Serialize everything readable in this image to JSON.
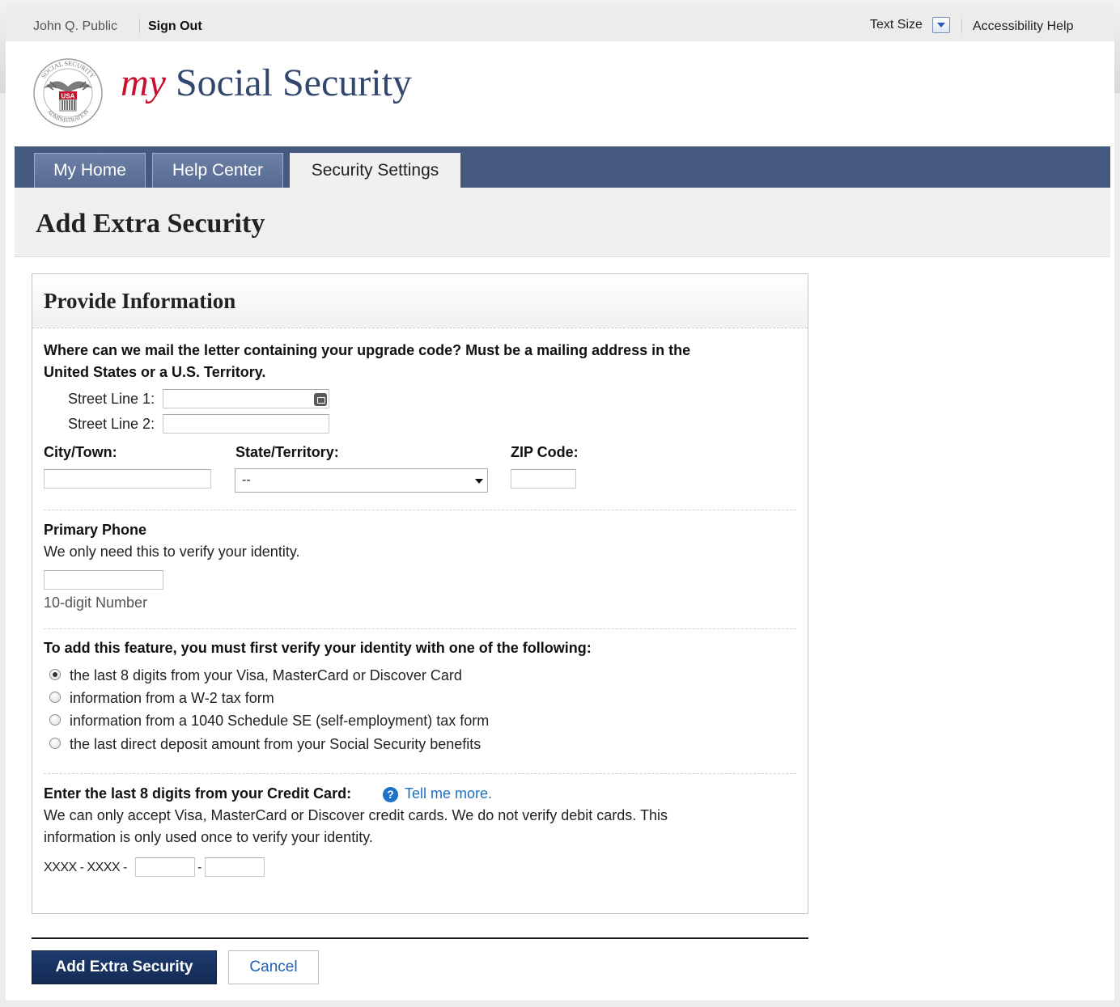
{
  "utility": {
    "user_name": "John Q. Public",
    "sign_out": "Sign Out",
    "text_size": "Text Size",
    "accessibility_help": "Accessibility Help"
  },
  "header": {
    "brand_my": "my",
    "brand_rest": "Social Security",
    "seal_text_top": "SOCIAL SECURITY",
    "seal_text_bottom": "ADMINISTRATION",
    "seal_center": "USA"
  },
  "nav": {
    "tabs": [
      {
        "label": "My Home",
        "active": false
      },
      {
        "label": "Help Center",
        "active": false
      },
      {
        "label": "Security Settings",
        "active": true
      }
    ]
  },
  "page": {
    "title": "Add Extra Security"
  },
  "panel": {
    "title": "Provide Information",
    "address": {
      "question_line1": "Where can we mail the letter containing your upgrade code? Must be a mailing address in the",
      "question_line2": "United States or a U.S. Territory.",
      "street1_label": "Street Line 1:",
      "street1_value": "",
      "street2_label": "Street Line 2:",
      "street2_value": "",
      "city_label": "City/Town:",
      "city_value": "",
      "state_label": "State/Territory:",
      "state_selected": "--",
      "zip_label": "ZIP Code:",
      "zip_value": ""
    },
    "phone": {
      "label": "Primary Phone",
      "help": "We only need this to verify your identity.",
      "value": "",
      "hint": "10-digit Number"
    },
    "verify": {
      "label": "To add this feature, you must first verify your identity with one of the following:",
      "options": [
        {
          "label": "the last 8 digits from your Visa, MasterCard or Discover Card",
          "checked": true
        },
        {
          "label": "information from a W-2 tax form",
          "checked": false
        },
        {
          "label": "information from a 1040 Schedule SE (self-employment) tax form",
          "checked": false
        },
        {
          "label": "the last direct deposit amount from your Social Security benefits",
          "checked": false
        }
      ]
    },
    "card": {
      "label": "Enter the last 8 digits from your Credit Card:",
      "help_icon": "?",
      "tell_more": "Tell me more.",
      "desc_line1": "We can only accept Visa, MasterCard or Discover credit cards. We do not verify debit cards. This",
      "desc_line2": "information is only used once to verify your identity.",
      "prefix": "XXXX - XXXX -",
      "separator": "-",
      "part1_value": "",
      "part2_value": ""
    }
  },
  "actions": {
    "submit": "Add Extra Security",
    "cancel": "Cancel"
  },
  "colors": {
    "nav_bg": "#465a80",
    "brand_red": "#c8102e",
    "brand_blue": "#33476e",
    "primary_button": "#1d3b6e",
    "link": "#1f6fc2"
  }
}
